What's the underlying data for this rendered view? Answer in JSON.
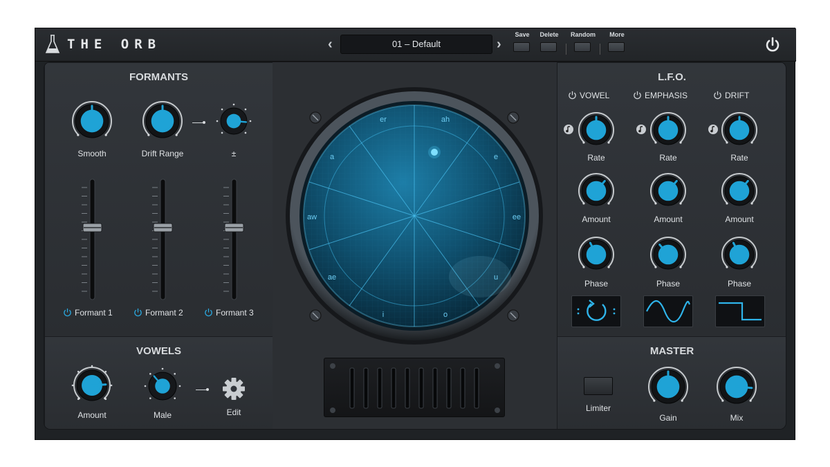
{
  "app": {
    "title": "THE ORB"
  },
  "topbar": {
    "preset": "01 – Default",
    "prev_arrow": "‹",
    "next_arrow": "›",
    "buttons": [
      {
        "label": "Save"
      },
      {
        "label": "Delete"
      },
      {
        "label": "Random"
      },
      {
        "label": "More"
      }
    ]
  },
  "formants": {
    "title": "FORMANTS",
    "knobs": [
      {
        "label": "Smooth",
        "value": 0.5
      },
      {
        "label": "Drift Range",
        "value": 0.5
      },
      {
        "label": "±",
        "value": 0.85
      }
    ],
    "faders": [
      {
        "label": "Formant 1",
        "value": 0.6
      },
      {
        "label": "Formant 2",
        "value": 0.6
      },
      {
        "label": "Formant 3",
        "value": 0.6
      }
    ]
  },
  "vowels": {
    "title": "VOWELS",
    "amount_label": "Amount",
    "amount_value": 0.82,
    "male_label": "Male",
    "male_value": 0.35,
    "edit_label": "Edit"
  },
  "orb": {
    "vowel_labels": [
      "er",
      "ah",
      "e",
      "ee",
      "u",
      "o",
      "i",
      "ae",
      "aw",
      "a"
    ]
  },
  "lfo": {
    "title": "L.F.O.",
    "columns": [
      {
        "name": "VOWEL",
        "rate_label": "Rate",
        "amount_label": "Amount",
        "phase_label": "Phase",
        "rate": 0.5,
        "amount": 0.65,
        "phase": 0.4,
        "shape": "cycle"
      },
      {
        "name": "EMPHASIS",
        "rate_label": "Rate",
        "amount_label": "Amount",
        "phase_label": "Phase",
        "rate": 0.5,
        "amount": 0.65,
        "phase": 0.35,
        "shape": "sine"
      },
      {
        "name": "DRIFT",
        "rate_label": "Rate",
        "amount_label": "Amount",
        "phase_label": "Phase",
        "rate": 0.5,
        "amount": 0.65,
        "phase": 0.4,
        "shape": "square"
      }
    ]
  },
  "master": {
    "title": "MASTER",
    "limiter_label": "Limiter",
    "gain_label": "Gain",
    "gain_value": 0.5,
    "mix_label": "Mix",
    "mix_value": 0.85
  },
  "colors": {
    "accent": "#1fa3d6",
    "orb_glow": "#0f5f80",
    "panel": "#2e3135",
    "background": "#1f2225"
  },
  "icons": {
    "logo": "flask-icon",
    "power": "power-icon",
    "sync": "note-icon",
    "edit": "gear-icon"
  }
}
